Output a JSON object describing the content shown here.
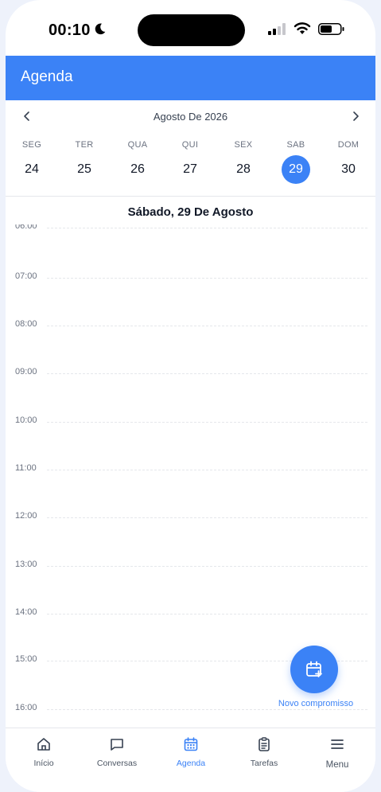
{
  "status_bar": {
    "time": "00:10"
  },
  "header": {
    "title": "Agenda"
  },
  "calendar": {
    "month_label": "Agosto De 2026",
    "week": [
      {
        "abbr": "SEG",
        "num": "24"
      },
      {
        "abbr": "TER",
        "num": "25"
      },
      {
        "abbr": "QUA",
        "num": "26"
      },
      {
        "abbr": "QUI",
        "num": "27"
      },
      {
        "abbr": "SEX",
        "num": "28"
      },
      {
        "abbr": "SAB",
        "num": "29",
        "selected": true
      },
      {
        "abbr": "DOM",
        "num": "30"
      }
    ]
  },
  "day_view": {
    "title": "Sábado, 29 De Agosto",
    "hours": [
      "06:00",
      "07:00",
      "08:00",
      "09:00",
      "10:00",
      "11:00",
      "12:00",
      "13:00",
      "14:00",
      "15:00",
      "16:00"
    ]
  },
  "fab": {
    "label": "Novo compromisso"
  },
  "bottom_nav": [
    {
      "label": "Início",
      "icon": "home-icon"
    },
    {
      "label": "Conversas",
      "icon": "chat-icon"
    },
    {
      "label": "Agenda",
      "icon": "calendar-icon",
      "active": true
    },
    {
      "label": "Tarefas",
      "icon": "clipboard-icon"
    },
    {
      "label": "Menu",
      "icon": "menu-icon"
    }
  ],
  "colors": {
    "accent": "#3b82f6",
    "background": "#eef2fb"
  }
}
